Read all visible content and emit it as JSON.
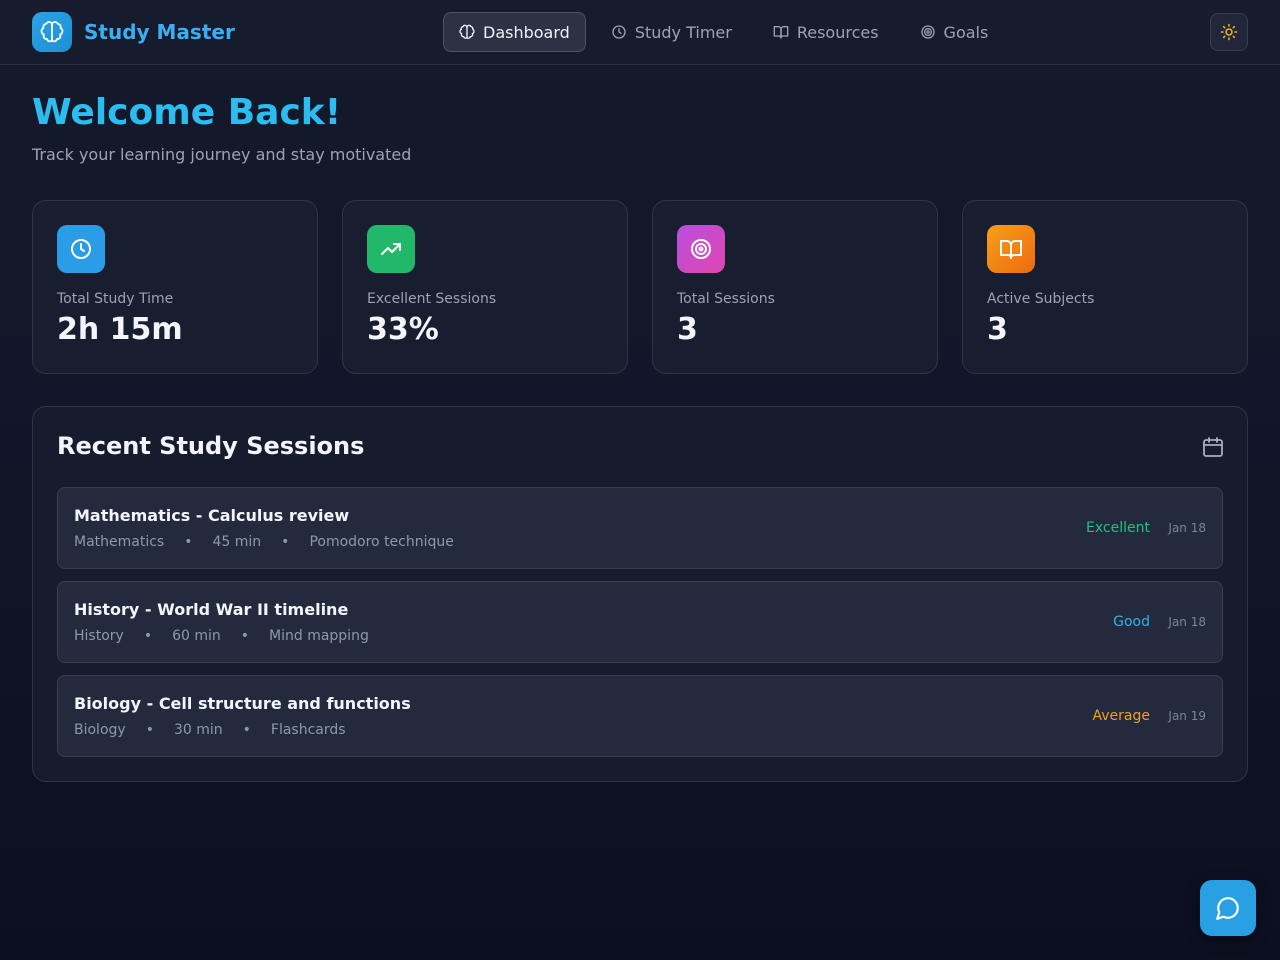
{
  "app": {
    "name": "Study Master",
    "logo_icon": "brain-icon"
  },
  "nav": {
    "items": [
      {
        "label": "Dashboard",
        "icon": "brain-icon",
        "active": true
      },
      {
        "label": "Study Timer",
        "icon": "clock-icon",
        "active": false
      },
      {
        "label": "Resources",
        "icon": "book-icon",
        "active": false
      },
      {
        "label": "Goals",
        "icon": "target-icon",
        "active": false
      }
    ]
  },
  "header": {
    "theme_toggle_icon": "sun-icon"
  },
  "welcome": {
    "title": "Welcome Back!",
    "subtitle": "Track your learning journey and stay motivated"
  },
  "stats": [
    {
      "label": "Total Study Time",
      "value": "2h 15m",
      "icon": "clock-icon",
      "color": "#2a9de6"
    },
    {
      "label": "Excellent Sessions",
      "value": "33%",
      "icon": "trending-up-icon",
      "color": "#22b86a"
    },
    {
      "label": "Total Sessions",
      "value": "3",
      "icon": "target-icon",
      "color": "#c34fd8"
    },
    {
      "label": "Active Subjects",
      "value": "3",
      "icon": "book-icon",
      "color": "#f08a14"
    }
  ],
  "recent": {
    "title": "Recent Study Sessions",
    "calendar_icon": "calendar-icon",
    "sessions": [
      {
        "title": "Mathematics - Calculus review",
        "subject": "Mathematics",
        "duration": "45 min",
        "method": "Pomodoro technique",
        "rating": "Excellent",
        "rating_color": "#22c07a",
        "date": "Jan 18"
      },
      {
        "title": "History - World War II timeline",
        "subject": "History",
        "duration": "60 min",
        "method": "Mind mapping",
        "rating": "Good",
        "rating_color": "#3aaef0",
        "date": "Jan 18"
      },
      {
        "title": "Biology - Cell structure and functions",
        "subject": "Biology",
        "duration": "30 min",
        "method": "Flashcards",
        "rating": "Average",
        "rating_color": "#f0a020",
        "date": "Jan 19"
      }
    ]
  },
  "separator": "•",
  "chat": {
    "icon": "chat-bubble-icon"
  }
}
